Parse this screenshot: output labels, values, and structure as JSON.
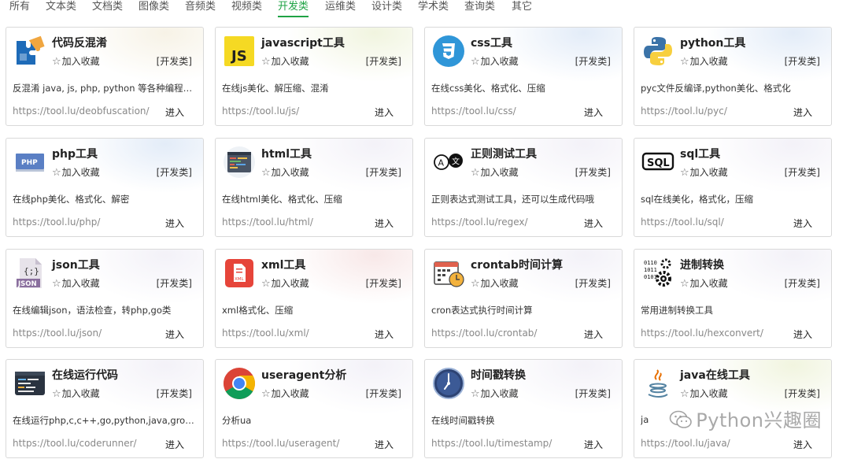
{
  "tabs": [
    "所有",
    "文本类",
    "文档类",
    "图像类",
    "音频类",
    "视频类",
    "开发类",
    "运维类",
    "设计类",
    "学术类",
    "查询类",
    "其它"
  ],
  "active_tab": "开发类",
  "fav_label": "加入收藏",
  "enter_label": "进入",
  "cards": [
    {
      "title": "代码反混淆",
      "category": "[开发类]",
      "desc": "反混淆 java, js, php, python 等各种编程…",
      "url": "https://tool.lu/deobfuscation/",
      "icon": "puzzle-icon"
    },
    {
      "title": "javascript工具",
      "category": "[开发类]",
      "desc": "在线js美化、解压缩、混淆",
      "url": "https://tool.lu/js/",
      "icon": "js-icon"
    },
    {
      "title": "css工具",
      "category": "[开发类]",
      "desc": "在线css美化、格式化、压缩",
      "url": "https://tool.lu/css/",
      "icon": "css3-icon"
    },
    {
      "title": "python工具",
      "category": "[开发类]",
      "desc": "pyc文件反编译,python美化、格式化",
      "url": "https://tool.lu/pyc/",
      "icon": "python-icon"
    },
    {
      "title": "php工具",
      "category": "[开发类]",
      "desc": "在线php美化、格式化、解密",
      "url": "https://tool.lu/php/",
      "icon": "php-icon"
    },
    {
      "title": "html工具",
      "category": "[开发类]",
      "desc": "在线html美化、格式化、压缩",
      "url": "https://tool.lu/html/",
      "icon": "html-code-icon"
    },
    {
      "title": "正则测试工具",
      "category": "[开发类]",
      "desc": "正则表达式测试工具，还可以生成代码哦",
      "url": "https://tool.lu/regex/",
      "icon": "regex-icon"
    },
    {
      "title": "sql工具",
      "category": "[开发类]",
      "desc": "sql在线美化，格式化，压缩",
      "url": "https://tool.lu/sql/",
      "icon": "sql-icon"
    },
    {
      "title": "json工具",
      "category": "[开发类]",
      "desc": "在线编辑json，语法检查，转php,go类",
      "url": "https://tool.lu/json/",
      "icon": "json-file-icon"
    },
    {
      "title": "xml工具",
      "category": "[开发类]",
      "desc": "xml格式化、压缩",
      "url": "https://tool.lu/xml/",
      "icon": "xml-file-icon"
    },
    {
      "title": "crontab时间计算",
      "category": "[开发类]",
      "desc": "cron表达式执行时间计算",
      "url": "https://tool.lu/crontab/",
      "icon": "calendar-clock-icon"
    },
    {
      "title": "进制转换",
      "category": "[开发类]",
      "desc": "常用进制转换工具",
      "url": "https://tool.lu/hexconvert/",
      "icon": "binary-gear-icon"
    },
    {
      "title": "在线运行代码",
      "category": "[开发类]",
      "desc": "在线运行php,c,c++,go,python,java,gro…",
      "url": "https://tool.lu/coderunner/",
      "icon": "terminal-icon"
    },
    {
      "title": "useragent分析",
      "category": "[开发类]",
      "desc": "分析ua",
      "url": "https://tool.lu/useragent/",
      "icon": "chrome-icon"
    },
    {
      "title": "时间戳转换",
      "category": "[开发类]",
      "desc": "在线时间戳转换",
      "url": "https://tool.lu/timestamp/",
      "icon": "clock-icon"
    },
    {
      "title": "java在线工具",
      "category": "[开发类]",
      "desc": "ja",
      "url": "https://tool.lu/java/",
      "icon": "java-icon"
    }
  ],
  "watermark": "Python兴趣圈"
}
